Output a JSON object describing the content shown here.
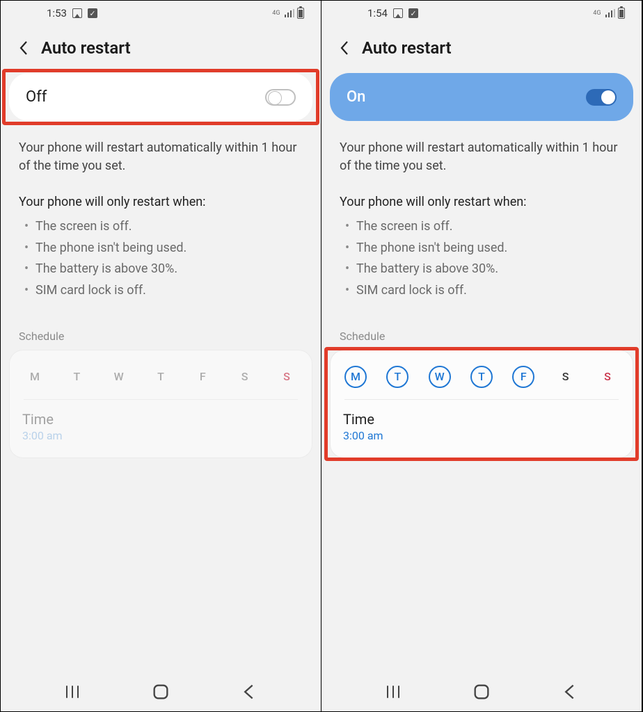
{
  "left": {
    "status": {
      "time": "1:53",
      "net": "4G"
    },
    "header": {
      "title": "Auto restart"
    },
    "toggle": {
      "label": "Off"
    },
    "desc": "Your phone will restart automatically within 1 hour of the time you set.",
    "condTitle": "Your phone will only restart when:",
    "conds": [
      "The screen is off.",
      "The phone isn't being used.",
      "The battery is above 30%.",
      "SIM card lock is off."
    ],
    "schedLabel": "Schedule",
    "days": [
      "M",
      "T",
      "W",
      "T",
      "F",
      "S",
      "S"
    ],
    "timeLabel": "Time",
    "timeValue": "3:00 am"
  },
  "right": {
    "status": {
      "time": "1:54",
      "net": "4G"
    },
    "header": {
      "title": "Auto restart"
    },
    "toggle": {
      "label": "On"
    },
    "desc": "Your phone will restart automatically within 1 hour of the time you set.",
    "condTitle": "Your phone will only restart when:",
    "conds": [
      "The screen is off.",
      "The phone isn't being used.",
      "The battery is above 30%.",
      "SIM card lock is off."
    ],
    "schedLabel": "Schedule",
    "days": [
      "M",
      "T",
      "W",
      "T",
      "F",
      "S",
      "S"
    ],
    "daysActive": [
      true,
      true,
      true,
      true,
      true,
      false,
      false
    ],
    "timeLabel": "Time",
    "timeValue": "3:00 am"
  }
}
